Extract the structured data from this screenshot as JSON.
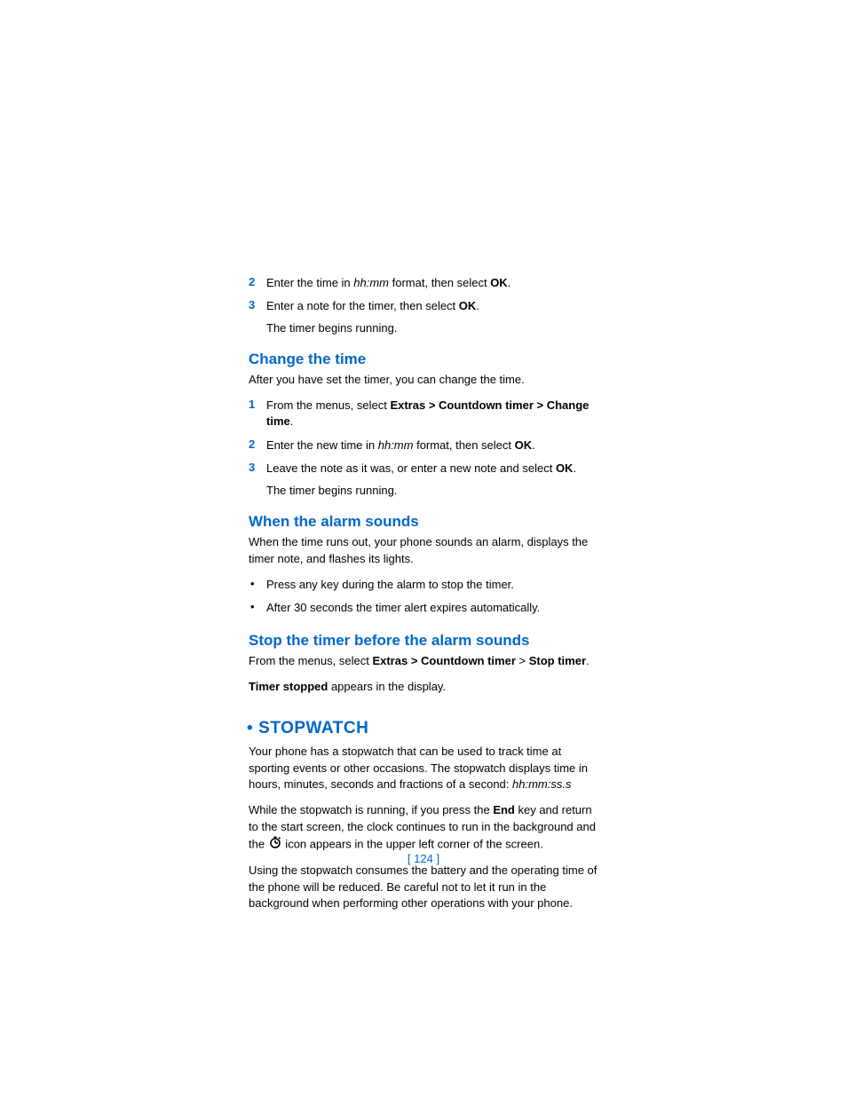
{
  "steps_top": [
    {
      "num": "2",
      "pre": "Enter the time in ",
      "italic": "hh:mm",
      "mid": " format, then select ",
      "bold": "OK",
      "post": "."
    },
    {
      "num": "3",
      "pre": "Enter a note for the timer, then select ",
      "italic": "",
      "mid": "",
      "bold": "OK",
      "post": "."
    }
  ],
  "top_sub": "The timer begins running.",
  "change": {
    "heading": "Change the time",
    "intro": "After you have set the timer, you can change the time.",
    "steps": [
      {
        "num": "1",
        "pre": "From the menus, select ",
        "bold": "Extras > Countdown timer > Change time",
        "post": "."
      },
      {
        "num": "2",
        "pre": "Enter the new time in ",
        "italic": "hh:mm",
        "mid": " format, then select ",
        "bold": "OK",
        "post": "."
      },
      {
        "num": "3",
        "pre": "Leave the note as it was, or enter a new note and select ",
        "bold": "OK",
        "post": "."
      }
    ],
    "sub": "The timer begins running."
  },
  "alarm": {
    "heading": "When the alarm sounds",
    "intro": "When the time runs out, your phone sounds an alarm, displays the timer note, and flashes its lights.",
    "bullets": [
      "Press any key during the alarm to stop the timer.",
      "After 30 seconds the timer alert expires automatically."
    ]
  },
  "stop": {
    "heading": "Stop the timer before the alarm sounds",
    "line1_pre": "From the menus, select ",
    "line1_bold1": "Extras > Countdown timer",
    "line1_mid": " > ",
    "line1_bold2": "Stop timer",
    "line1_post": ".",
    "line2_bold": "Timer stopped",
    "line2_post": " appears in the display."
  },
  "stopwatch": {
    "heading": "STOPWATCH",
    "p1_pre": "Your phone has a stopwatch that can be used to track time at sporting events or other occasions. The stopwatch displays time in hours, minutes, seconds and fractions of a second: ",
    "p1_italic": "hh:mm:ss.s",
    "p2_pre": "While the stopwatch is running, if you press the ",
    "p2_bold": "End",
    "p2_mid": " key and return to the start screen, the clock continues to run in the background and the ",
    "p2_post": " icon appears in the upper left corner of the screen.",
    "p3": "Using the stopwatch consumes the battery and the operating time of the phone will be reduced. Be careful not to let it run in the background when performing other operations with your phone."
  },
  "page_number": "[ 124 ]"
}
